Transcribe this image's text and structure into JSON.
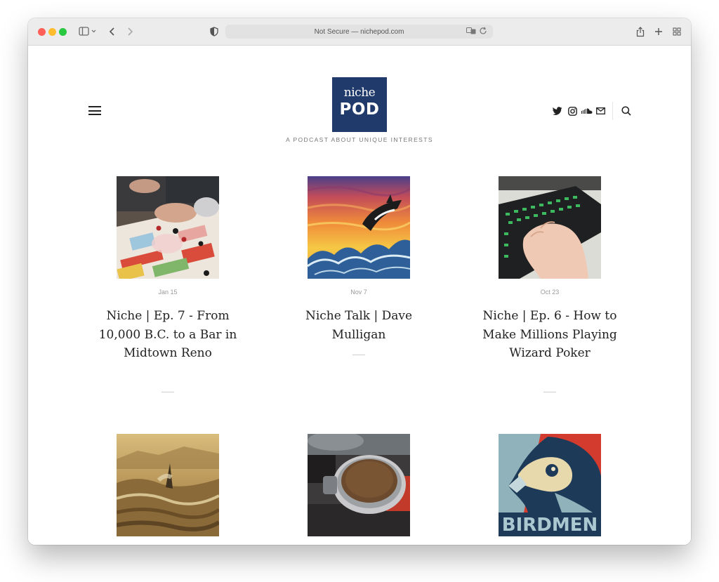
{
  "browser": {
    "address_text": "Not Secure — nichepod.com"
  },
  "site": {
    "logo_line1": "niche",
    "logo_line2": "POD",
    "tagline": "A PODCAST ABOUT UNIQUE INTERESTS",
    "logo_bg_color": "#1f3a6b"
  },
  "social_icons": [
    "twitter-icon",
    "instagram-icon",
    "soundcloud-icon",
    "mail-icon",
    "search-icon"
  ],
  "posts": [
    {
      "date": "Jan 15",
      "title": "Niche | Ep. 7 - From 10,000 B.C. to a Bar in Midtown Reno",
      "image": "board-game-photo"
    },
    {
      "date": "Nov 7",
      "title": "Niche Talk | Dave Mulligan",
      "image": "orca-sunset-painting"
    },
    {
      "date": "Oct 23",
      "title": "Niche | Ep. 6 - How to Make Millions Playing Wizard Poker",
      "image": "keyboard-hand-photo"
    },
    {
      "date": "",
      "title": "",
      "image": "windsurfer-photo"
    },
    {
      "date": "",
      "title": "",
      "image": "coffee-portafilter-photo"
    },
    {
      "date": "",
      "title": "",
      "image": "birdmen-poster",
      "image_text": "BIRDMEN"
    }
  ]
}
